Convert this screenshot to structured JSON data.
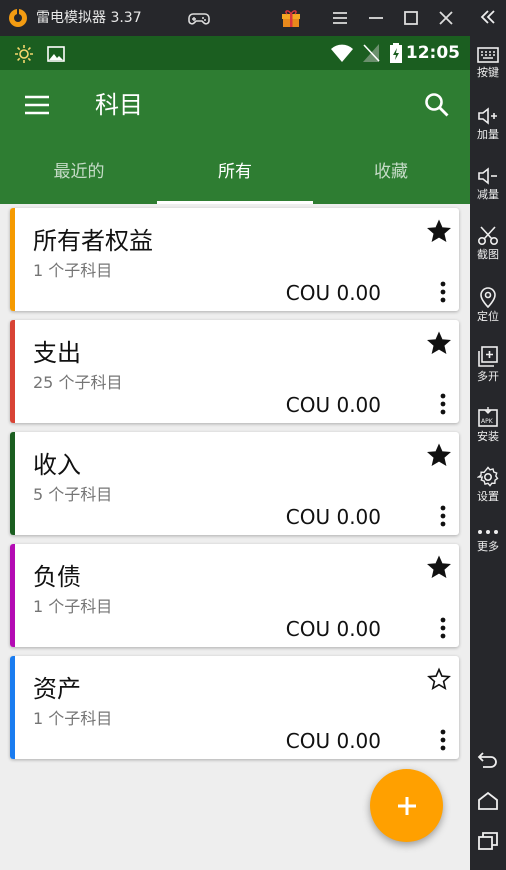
{
  "emulator": {
    "title": "雷电模拟器 3.37",
    "sidebar": [
      {
        "label": "按键",
        "icon": "keyboard-icon"
      },
      {
        "label": "加量",
        "icon": "volume-up-icon"
      },
      {
        "label": "减量",
        "icon": "volume-down-icon"
      },
      {
        "label": "截图",
        "icon": "scissors-icon"
      },
      {
        "label": "定位",
        "icon": "location-icon"
      },
      {
        "label": "多开",
        "icon": "multi-instance-icon"
      },
      {
        "label": "安装",
        "icon": "apk-install-icon"
      },
      {
        "label": "设置",
        "icon": "gear-icon"
      },
      {
        "label": "更多",
        "icon": "more-horizontal-icon"
      }
    ]
  },
  "statusbar": {
    "time": "12:05"
  },
  "appbar": {
    "title": "科目"
  },
  "tabs": [
    {
      "label": "最近的",
      "active": false
    },
    {
      "label": "所有",
      "active": true
    },
    {
      "label": "收藏",
      "active": false
    }
  ],
  "accounts": [
    {
      "name": "所有者权益",
      "subaccounts": "1 个子科目",
      "balance": "COU 0.00",
      "color": "#f59a00",
      "favorite": true
    },
    {
      "name": "支出",
      "subaccounts": "25 个子科目",
      "balance": "COU 0.00",
      "color": "#d84335",
      "favorite": true
    },
    {
      "name": "收入",
      "subaccounts": "5 个子科目",
      "balance": "COU 0.00",
      "color": "#1b5e20",
      "favorite": true
    },
    {
      "name": "负债",
      "subaccounts": "1 个子科目",
      "balance": "COU 0.00",
      "color": "#b40bb4",
      "favorite": true
    },
    {
      "name": "资产",
      "subaccounts": "1 个子科目",
      "balance": "COU 0.00",
      "color": "#1a7cf0",
      "favorite": false
    }
  ],
  "colors": {
    "primary": "#2e7d32",
    "primary_dark": "#1b5e20",
    "fab": "#ffa000"
  }
}
